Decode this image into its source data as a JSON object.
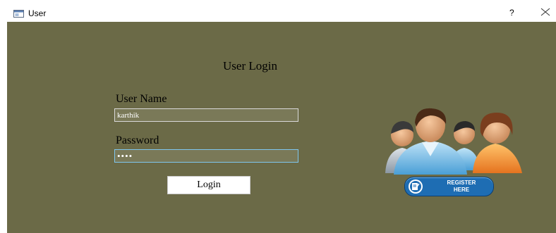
{
  "window": {
    "title": "User",
    "help_label": "?"
  },
  "form": {
    "heading": "User Login",
    "username_label": "User Name",
    "username_value": "karthik",
    "password_label": "Password",
    "password_value": "••••",
    "login_label": "Login"
  },
  "register": {
    "line1": "REGISTER",
    "line2": "HERE"
  },
  "icons": {
    "app": "window-icon",
    "close": "close-icon",
    "users": "users-group-icon",
    "register": "edit-icon"
  },
  "colors": {
    "background": "#6b6a47",
    "field_background": "#7a7958",
    "register_button": "#1e6db3"
  }
}
